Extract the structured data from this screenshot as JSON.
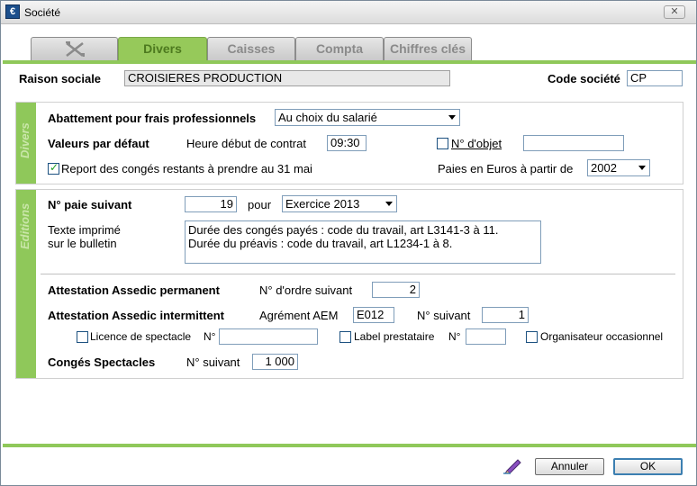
{
  "window": {
    "title": "Société",
    "close_glyph": "✕"
  },
  "tabs": [
    {
      "label": "",
      "icon": "tools-icon"
    },
    {
      "label": "Divers",
      "active": true
    },
    {
      "label": "Caisses"
    },
    {
      "label": "Compta"
    },
    {
      "label": "Chiffres clés"
    }
  ],
  "header": {
    "raison_label": "Raison sociale",
    "raison_value": "CROISIERES PRODUCTION",
    "code_label": "Code société",
    "code_value": "CP"
  },
  "divers": {
    "side_label": "Divers",
    "abattement_label": "Abattement pour frais professionnels",
    "abattement_value": "Au choix du salarié",
    "valeurs_label": "Valeurs par défaut",
    "heure_label": "Heure début de contrat",
    "heure_value": "09:30",
    "objet_label": "N° d'objet",
    "objet_checked": false,
    "objet_value": "",
    "report_label": "Report des congés restants à prendre au 31 mai",
    "report_checked": true,
    "paies_label": "Paies en Euros à partir de",
    "paies_value": "2002"
  },
  "editions": {
    "side_label": "Editions",
    "paie_label": "N° paie suivant",
    "paie_value": "19",
    "pour_label": "pour",
    "exercice_value": "Exercice 2013",
    "texte_label_1": "Texte imprimé",
    "texte_label_2": "sur le bulletin",
    "texte_line_1": "Durée des congés payés : code du travail, art L3141-3 à 11.",
    "texte_line_2": "Durée du préavis : code du travail, art L1234-1 à 8.",
    "assedic_perm_label": "Attestation Assedic permanent",
    "ordre_label": "N° d'ordre suivant",
    "ordre_value": "2",
    "assedic_inter_label": "Attestation Assedic intermittent",
    "agrement_label": "Agrément AEM",
    "agrement_value": "E012",
    "suivant_label": "N° suivant",
    "suivant_value": "1",
    "licence_label": "Licence de spectacle",
    "licence_no_label": "N°",
    "licence_value": "",
    "label_prest_label": "Label prestataire",
    "label_prest_no_label": "N°",
    "label_prest_value": "",
    "organisateur_label": "Organisateur occasionnel",
    "conges_label": "Congés Spectacles",
    "conges_suivant_label": "N° suivant",
    "conges_value": "1 000"
  },
  "footer": {
    "annuler_label": "Annuler",
    "ok_label": "OK"
  }
}
